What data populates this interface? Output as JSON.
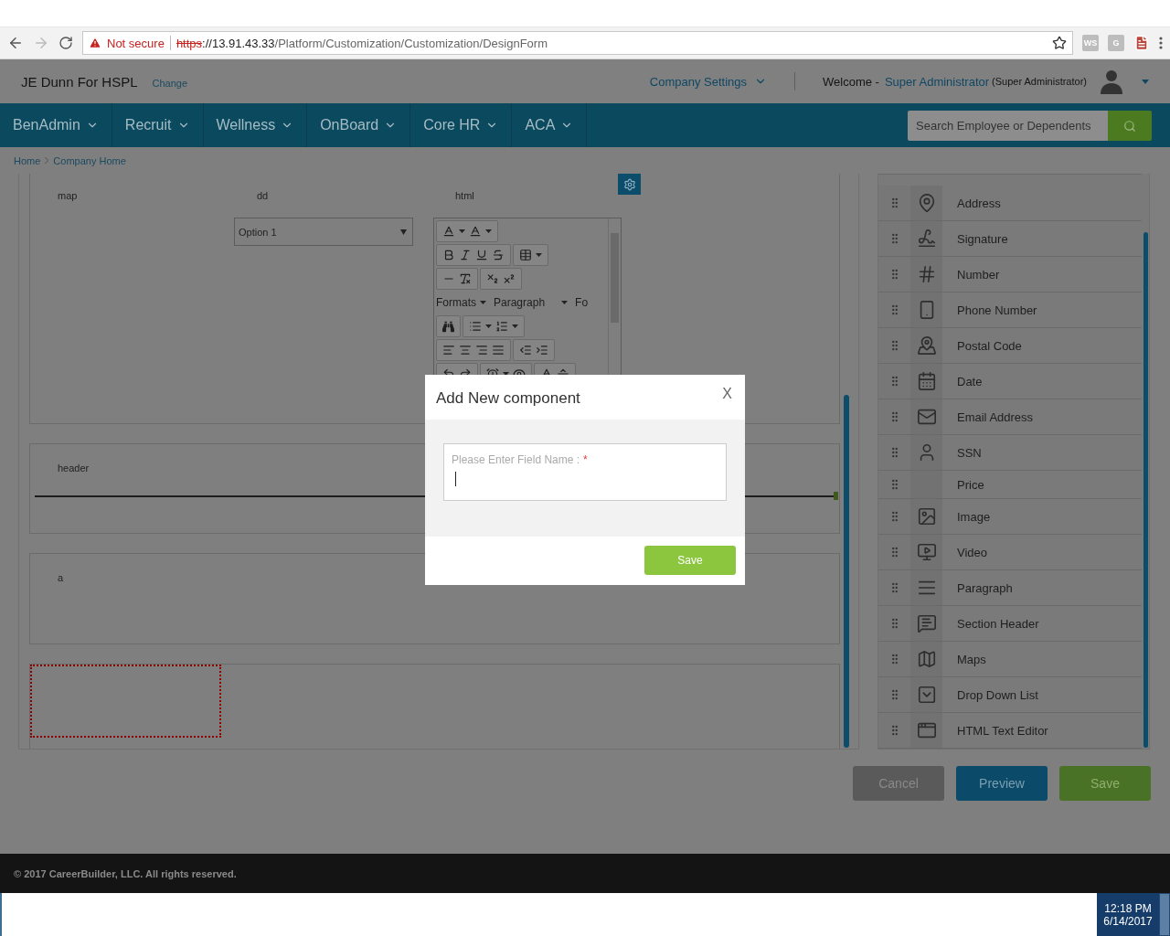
{
  "browser": {
    "security": "Not secure",
    "url_scheme": "https",
    "url_host": "://13.91.43.33",
    "url_path": "/Platform/Customization/Customization/DesignForm",
    "extensions": [
      {
        "kind": "badge",
        "label": "WS"
      },
      {
        "kind": "badge",
        "label": "G"
      },
      {
        "kind": "pdf"
      }
    ]
  },
  "header": {
    "company": "JE Dunn For HSPL",
    "change_link": "Change",
    "settings_menu": "Company Settings",
    "welcome": "Welcome -",
    "user_name": "Super Administrator",
    "user_role": "(Super Administrator)"
  },
  "nav": {
    "items": [
      {
        "label": "BenAdmin"
      },
      {
        "label": "Recruit"
      },
      {
        "label": "Wellness"
      },
      {
        "label": "OnBoard"
      },
      {
        "label": "Core HR"
      },
      {
        "label": "ACA"
      }
    ],
    "search_placeholder": "Search Employee or Dependents"
  },
  "breadcrumb": [
    "Home",
    "Company Home"
  ],
  "canvas": {
    "sections": [
      {
        "kind": "fields",
        "fields": [
          {
            "kind": "map",
            "label": "map"
          },
          {
            "kind": "dropdown",
            "label": "dd",
            "value": "Option 1"
          },
          {
            "kind": "editor",
            "label": "html",
            "formats": "Formats",
            "block": "Paragraph",
            "font": "Fo"
          }
        ]
      },
      {
        "kind": "header",
        "label": "header"
      },
      {
        "kind": "text",
        "label": "a"
      },
      {
        "kind": "drop_target"
      }
    ]
  },
  "palette": {
    "items": [
      {
        "kind": "address",
        "label": "Address"
      },
      {
        "kind": "signature",
        "label": "Signature"
      },
      {
        "kind": "number",
        "label": "Number"
      },
      {
        "kind": "phone",
        "label": "Phone Number"
      },
      {
        "kind": "postal",
        "label": "Postal Code"
      },
      {
        "kind": "date",
        "label": "Date"
      },
      {
        "kind": "email",
        "label": "Email Address"
      },
      {
        "kind": "ssn",
        "label": "SSN"
      },
      {
        "kind": "price",
        "label": "Price"
      },
      {
        "kind": "image",
        "label": "Image"
      },
      {
        "kind": "video",
        "label": "Video"
      },
      {
        "kind": "paragraph",
        "label": "Paragraph"
      },
      {
        "kind": "section",
        "label": "Section Header"
      },
      {
        "kind": "maps",
        "label": "Maps"
      },
      {
        "kind": "dropdown",
        "label": "Drop Down List"
      },
      {
        "kind": "html",
        "label": "HTML Text Editor"
      }
    ]
  },
  "actions": [
    {
      "kind": "cancel",
      "label": "Cancel"
    },
    {
      "kind": "preview",
      "label": "Preview"
    },
    {
      "kind": "save",
      "label": "Save"
    }
  ],
  "modal": {
    "title": "Add New component",
    "close": "X",
    "field_label": "Please Enter Field Name :",
    "required_mark": "*",
    "focused": true,
    "save": "Save"
  },
  "footer": "© 2017 CareerBuilder, LLC. All rights reserved.",
  "taskbar": {
    "time": "12:18 PM",
    "date": "6/14/2017"
  }
}
